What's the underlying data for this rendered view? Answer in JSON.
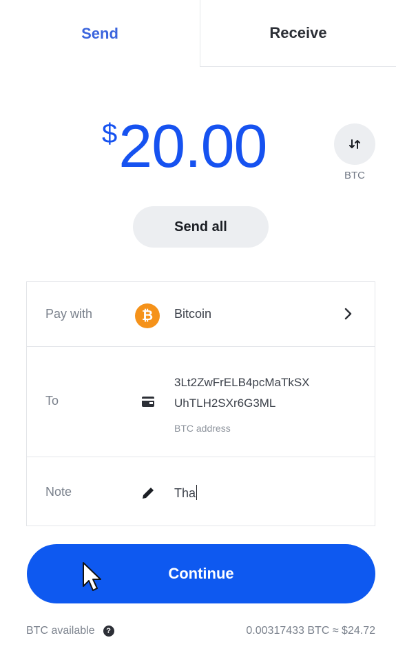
{
  "tabs": {
    "send": "Send",
    "receive": "Receive"
  },
  "amount": {
    "currency_symbol": "$",
    "value": "20.00",
    "toggle_label": "BTC",
    "swap_icon": "swap-arrows-icon"
  },
  "send_all_label": "Send all",
  "form": {
    "pay_with": {
      "label": "Pay with",
      "asset_icon_glyph": "₿",
      "asset": "Bitcoin"
    },
    "to": {
      "label": "To",
      "address_line1": "3Lt2ZwFrELB4pcMaTkSX",
      "address_line2": "UhTLH2SXr6G3ML",
      "sub_label": "BTC address"
    },
    "note": {
      "label": "Note",
      "value": "Tha"
    }
  },
  "continue_label": "Continue",
  "footer": {
    "available_label": "BTC available",
    "balance": "0.00317433 BTC ≈ $24.72"
  },
  "colors": {
    "accent": "#1652f0",
    "button": "#0e59f0",
    "bitcoin": "#f5921a"
  }
}
